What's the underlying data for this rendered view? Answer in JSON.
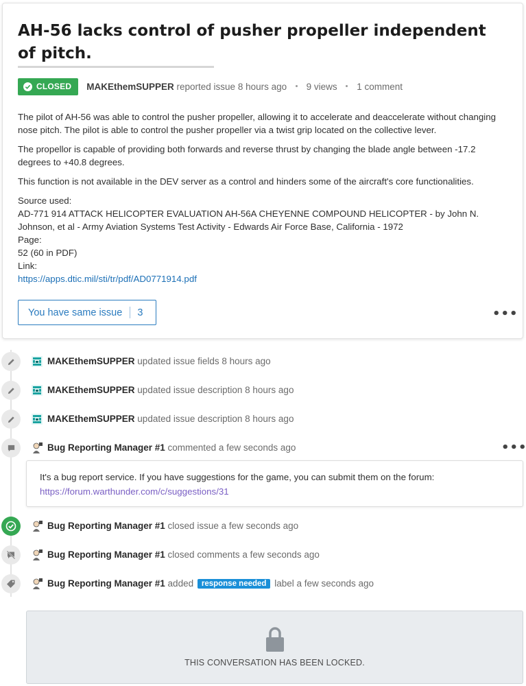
{
  "issue": {
    "title": "AH-56 lacks control of pusher propeller independent of pitch.",
    "status_badge": "CLOSED",
    "author": "MAKEthemSUPPER",
    "reported_text": "reported issue 8 hours ago",
    "views": "9 views",
    "comments": "1 comment",
    "paragraphs": [
      "The pilot of AH-56 was able to control the pusher propeller, allowing it to accelerate and deaccelerate without changing nose pitch. The pilot is able to control the pusher propeller via a twist grip located on the collective lever.",
      "The propellor is capable of providing both forwards and reverse thrust by changing the blade angle between -17.2 degrees to +40.8 degrees.",
      "This function is not available in the DEV server as a control and hinders some of the aircraft's core functionalities."
    ],
    "source_label": "Source used:",
    "source_text": "AD-771 914 ATTACK HELICOPTER EVALUATION AH-56A CHEYENNE COMPOUND HELICOPTER - by John N. Johnson, et al - Army Aviation Systems Test Activity - Edwards Air Force Base, California - 1972",
    "page_label": "Page:",
    "page_value": "52 (60 in PDF)",
    "link_label": "Link:",
    "link_url": "https://apps.dtic.mil/sti/tr/pdf/AD0771914.pdf",
    "same_issue_label": "You have same issue",
    "same_issue_count": "3",
    "more_label": "•••"
  },
  "timeline": [
    {
      "icon": "pencil-icon",
      "user": "MAKEthemSUPPER",
      "action": "updated issue fields 8 hours ago"
    },
    {
      "icon": "pencil-icon",
      "user": "MAKEthemSUPPER",
      "action": "updated issue description 8 hours ago"
    },
    {
      "icon": "pencil-icon",
      "user": "MAKEthemSUPPER",
      "action": "updated issue description 8 hours ago"
    },
    {
      "icon": "comment-icon",
      "user": "Bug Reporting Manager #1",
      "action": "commented a few seconds ago"
    },
    {
      "icon": "check-icon",
      "user": "Bug Reporting Manager #1",
      "action": "closed issue a few seconds ago"
    },
    {
      "icon": "comments-closed-icon",
      "user": "Bug Reporting Manager #1",
      "action": "closed comments a few seconds ago"
    },
    {
      "icon": "tag-icon",
      "user": "Bug Reporting Manager #1",
      "action_before": "added",
      "label": "response needed",
      "action_after": "label a few seconds ago"
    }
  ],
  "comment": {
    "text": "It's a bug report service. If you have suggestions for the game, you can submit them on the forum:",
    "link": "https://forum.warthunder.com/c/suggestions/31",
    "more_label": "•••"
  },
  "locked_text": "THIS CONVERSATION HAS BEEN LOCKED.",
  "colors": {
    "closed_green": "#35a853",
    "link_blue": "#1b6fb6",
    "label_blue": "#1a8fd8",
    "comment_link_purple": "#7a5fc4"
  }
}
